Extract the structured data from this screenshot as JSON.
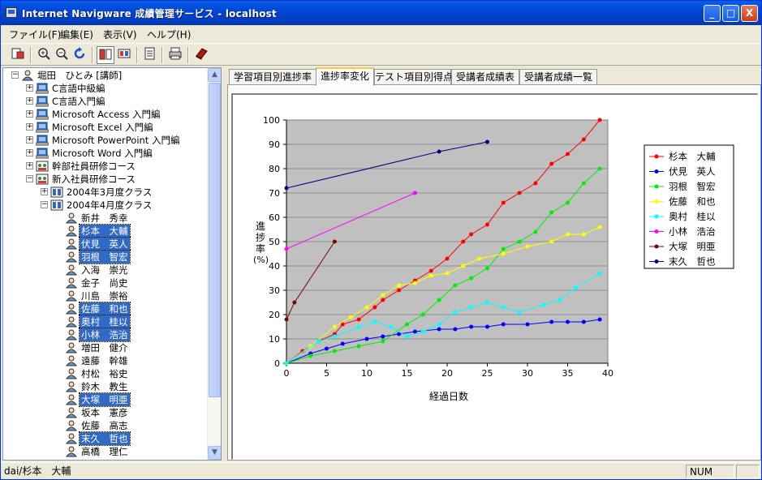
{
  "window": {
    "title": "Internet Navigware 成績管理サービス - localhost",
    "controls": {
      "minimize": "_",
      "maximize": "□",
      "close": "X"
    }
  },
  "menu": [
    "ファイル(F)",
    "編集(E)",
    "表示(V)",
    "ヘルプ(H)"
  ],
  "toolbar": {
    "icons": [
      "report-icon",
      "zoom-in-icon",
      "zoom-out-icon",
      "refresh-icon",
      "view-chart-icon",
      "view-table-icon",
      "export-icon",
      "print-icon",
      "book-icon"
    ],
    "pressed": "view-chart-icon"
  },
  "tree": {
    "root": "堀田　ひとみ [講師]",
    "courses": [
      "C言語中級編",
      "C言語入門編",
      "Microsoft Access 入門編",
      "Microsoft Excel 入門編",
      "Microsoft PowerPoint 入門編",
      "Microsoft Word 入門編",
      "幹部社員研修コース",
      "新入社員研修コース"
    ],
    "classes": [
      "2004年3月度クラス",
      "2004年4月度クラス"
    ],
    "students": [
      {
        "name": "新井　秀幸",
        "selected": false
      },
      {
        "name": "杉本　大輔",
        "selected": true
      },
      {
        "name": "伏見　英人",
        "selected": true
      },
      {
        "name": "羽根　智宏",
        "selected": true
      },
      {
        "name": "入海　崇光",
        "selected": false
      },
      {
        "name": "金子　尚史",
        "selected": false
      },
      {
        "name": "川島　崇裕",
        "selected": false
      },
      {
        "name": "佐藤　和也",
        "selected": true
      },
      {
        "name": "奥村　桂以",
        "selected": true
      },
      {
        "name": "小林　浩治",
        "selected": true
      },
      {
        "name": "増田　健介",
        "selected": false
      },
      {
        "name": "遠藤　幹雄",
        "selected": false
      },
      {
        "name": "村松　裕史",
        "selected": false
      },
      {
        "name": "鈴木　教生",
        "selected": false
      },
      {
        "name": "大塚　明亜",
        "selected": true
      },
      {
        "name": "坂本　憲彦",
        "selected": false
      },
      {
        "name": "佐藤　高志",
        "selected": false
      },
      {
        "name": "末久　哲也",
        "selected": true
      },
      {
        "name": "高橋　理仁",
        "selected": false
      }
    ]
  },
  "tabs": [
    "学習項目別進捗率",
    "進捗率変化",
    "テスト項目別得点",
    "受講者成績表",
    "受講者成績一覧"
  ],
  "active_tab": 1,
  "status": {
    "left": "dai/杉本　大輔",
    "num": "NUM"
  },
  "chart_data": {
    "type": "line",
    "title": "",
    "xlabel": "経過日数",
    "ylabel": "進捗率(%)",
    "xlim": [
      0,
      40
    ],
    "ylim": [
      0,
      100
    ],
    "xticks": [
      0,
      5,
      10,
      15,
      20,
      25,
      30,
      35,
      40
    ],
    "yticks": [
      0,
      10,
      20,
      30,
      40,
      50,
      60,
      70,
      80,
      90,
      100
    ],
    "grid": true,
    "legend": "right",
    "series": [
      {
        "name": "杉本　大輔",
        "color": "#ff0000",
        "x": [
          0,
          2,
          4,
          6,
          7,
          9,
          11,
          12,
          14,
          16,
          18,
          20,
          22,
          23,
          25,
          27,
          29,
          31,
          33,
          35,
          37,
          39
        ],
        "y": [
          0,
          5,
          9,
          12,
          16,
          18,
          23,
          26,
          30,
          34,
          38,
          43,
          50,
          53,
          57,
          66,
          70,
          74,
          82,
          86,
          92,
          100
        ]
      },
      {
        "name": "伏見　英人",
        "color": "#0000ff",
        "x": [
          0,
          3,
          5,
          7,
          10,
          12,
          14,
          16,
          19,
          21,
          23,
          25,
          27,
          30,
          33,
          35,
          37,
          39
        ],
        "y": [
          0,
          4,
          6,
          8,
          10,
          11,
          12,
          13,
          14,
          14,
          15,
          15,
          16,
          16,
          17,
          17,
          17,
          18
        ]
      },
      {
        "name": "羽根　智宏",
        "color": "#00ee00",
        "x": [
          0,
          3,
          6,
          9,
          12,
          15,
          17,
          19,
          21,
          23,
          25,
          27,
          29,
          31,
          33,
          35,
          37,
          39
        ],
        "y": [
          0,
          3,
          5,
          7,
          9,
          16,
          20,
          26,
          32,
          35,
          39,
          47,
          50,
          54,
          62,
          66,
          74,
          80
        ]
      },
      {
        "name": "佐藤　和也",
        "color": "#ffff00",
        "x": [
          0,
          3,
          6,
          8,
          10,
          12,
          14,
          16,
          18,
          20,
          22,
          24,
          27,
          30,
          33,
          35,
          37,
          39
        ],
        "y": [
          0,
          7,
          15,
          19,
          23,
          28,
          32,
          33,
          36,
          37,
          40,
          43,
          45,
          48,
          50,
          53,
          53,
          56
        ]
      },
      {
        "name": "奥村　桂以",
        "color": "#00ffff",
        "x": [
          0,
          4,
          6,
          9,
          11,
          13,
          15,
          17,
          19,
          21,
          23,
          25,
          27,
          29,
          32,
          34,
          36,
          39
        ],
        "y": [
          0,
          9,
          11,
          15,
          17,
          15,
          11,
          13,
          16,
          21,
          23,
          25,
          23,
          21,
          24,
          26,
          31,
          37
        ]
      },
      {
        "name": "小林　浩治",
        "color": "#ff00ff",
        "x": [
          0,
          16
        ],
        "y": [
          47,
          70
        ]
      },
      {
        "name": "大塚　明亜",
        "color": "#800000",
        "x": [
          0,
          1,
          6
        ],
        "y": [
          18,
          25,
          50
        ]
      },
      {
        "name": "末久　哲也",
        "color": "#000080",
        "x": [
          0,
          19,
          25
        ],
        "y": [
          72,
          87,
          91
        ]
      }
    ]
  }
}
